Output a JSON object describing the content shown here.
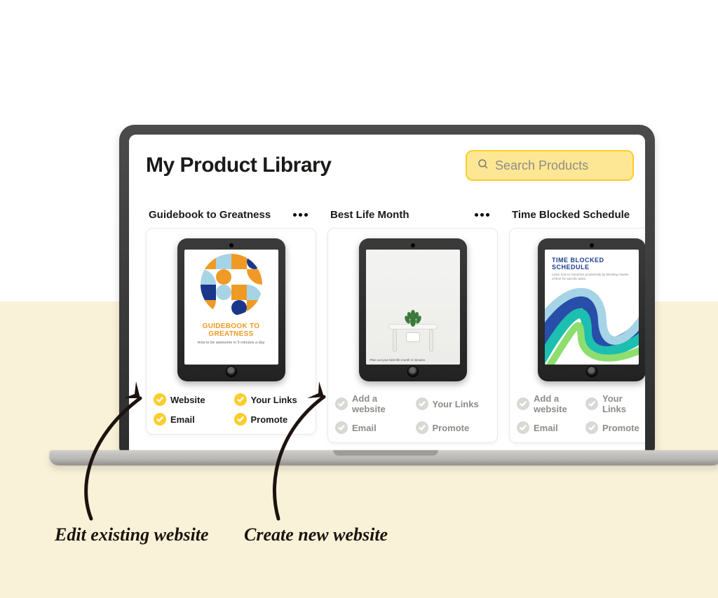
{
  "header": {
    "title": "My Product Library",
    "search_placeholder": "Search Products"
  },
  "products": [
    {
      "title": "Guidebook to Greatness",
      "cover": {
        "line1": "GUIDEBOOK TO GREATNESS",
        "line2": "How to be awesome in 5 minutes a day"
      },
      "chips": [
        {
          "label": "Website",
          "active": true
        },
        {
          "label": "Your Links",
          "active": true
        },
        {
          "label": "Email",
          "active": true
        },
        {
          "label": "Promote",
          "active": true
        }
      ]
    },
    {
      "title": "Best Life Month",
      "cover": {
        "caption": "Plan out your best life month in minutes"
      },
      "chips": [
        {
          "label": "Add a website",
          "active": false
        },
        {
          "label": "Your Links",
          "active": false
        },
        {
          "label": "Email",
          "active": false
        },
        {
          "label": "Promote",
          "active": false
        }
      ]
    },
    {
      "title": "Time Blocked Schedule",
      "cover": {
        "line1": "TIME BLOCKED SCHEDULE",
        "line2": "Learn how to maximize productivity by blocking chunks of time for specific tasks."
      },
      "chips": [
        {
          "label": "Add a website",
          "active": false
        },
        {
          "label": "Your Links",
          "active": false
        },
        {
          "label": "Email",
          "active": false
        },
        {
          "label": "Promote",
          "active": false
        }
      ]
    }
  ],
  "annotations": {
    "left": "Edit existing website",
    "right": "Create new website"
  }
}
